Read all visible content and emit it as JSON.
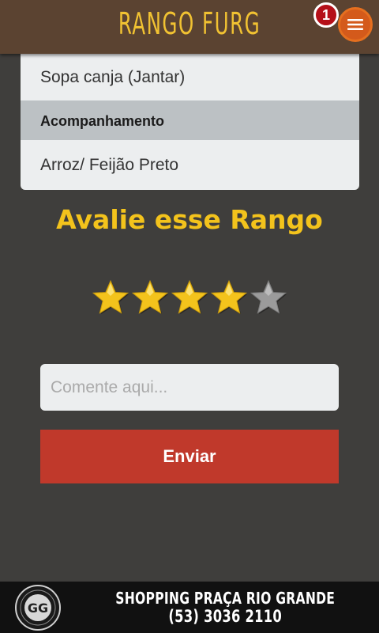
{
  "header": {
    "title": "RANGO FURG",
    "menu_icon": "hamburger-menu-icon",
    "notification_count": "1",
    "colors": {
      "background": "#5b4331",
      "title": "#f1c232",
      "menu_button": "#d45a1b",
      "badge": "#b51019"
    }
  },
  "menu": {
    "items": [
      {
        "label": "Sopa canja (Jantar)"
      },
      {
        "label": "Acompanhamento"
      },
      {
        "label": "Arroz/ Feijão Preto"
      }
    ]
  },
  "rating": {
    "title": "Avalie esse Rango",
    "value": 4,
    "max": 5,
    "star_icon": "star-icon",
    "colors": {
      "filled": "#f3c31c",
      "empty": "#9b9b9b"
    }
  },
  "comment": {
    "placeholder": "Comente aqui...",
    "value": ""
  },
  "submit": {
    "label": "Enviar",
    "color": "#c0392b"
  },
  "ad": {
    "logo_text": "GG",
    "line1": "SHOPPING PRAÇA RIO GRANDE",
    "line2": "(53) 3036 2110"
  }
}
